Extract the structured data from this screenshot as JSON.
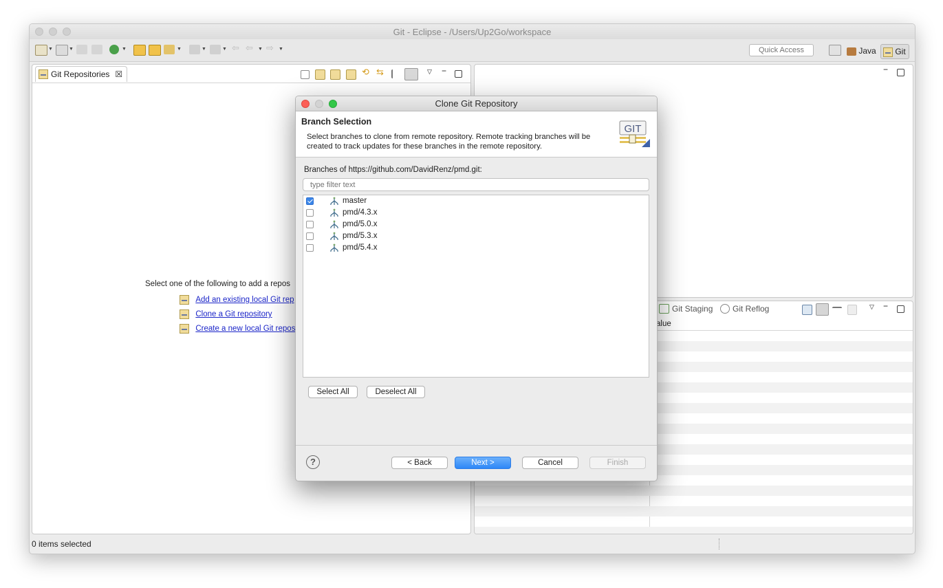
{
  "window": {
    "title": "Git - Eclipse - /Users/Up2Go/workspace"
  },
  "toolbar": {
    "quick_access_placeholder": "Quick Access"
  },
  "perspectives": [
    {
      "label": "Java",
      "icon": "java-perspective-icon"
    },
    {
      "label": "Git",
      "icon": "git-perspective-icon"
    }
  ],
  "left_view": {
    "tab_label": "Git Repositories",
    "tab_close": "☒",
    "empty_prompt": "Select one of the following to add a repos",
    "links": [
      {
        "label": "Add an existing local Git rep"
      },
      {
        "label": "Clone a Git repository"
      },
      {
        "label": "Create a new local Git repos"
      }
    ]
  },
  "bottom_right_view": {
    "tabs": [
      {
        "label": "Git Staging"
      },
      {
        "label": "Git Reflog"
      }
    ],
    "column_header": "alue"
  },
  "status_bar": {
    "text": "0 items selected"
  },
  "dialog": {
    "title": "Clone Git Repository",
    "header_title": "Branch Selection",
    "header_description": "Select branches to clone from remote repository. Remote tracking branches will be created to track updates for these branches in the remote repository.",
    "badge_text": "GIT",
    "branches_label": "Branches of https://github.com/DavidRenz/pmd.git:",
    "filter_placeholder": "type filter text",
    "branches": [
      {
        "name": "master",
        "checked": true
      },
      {
        "name": "pmd/4.3.x",
        "checked": false
      },
      {
        "name": "pmd/5.0.x",
        "checked": false
      },
      {
        "name": "pmd/5.3.x",
        "checked": false
      },
      {
        "name": "pmd/5.4.x",
        "checked": false
      }
    ],
    "select_all": "Select All",
    "deselect_all": "Deselect All",
    "help": "?",
    "back": "< Back",
    "next": "Next >",
    "cancel": "Cancel",
    "finish": "Finish"
  }
}
